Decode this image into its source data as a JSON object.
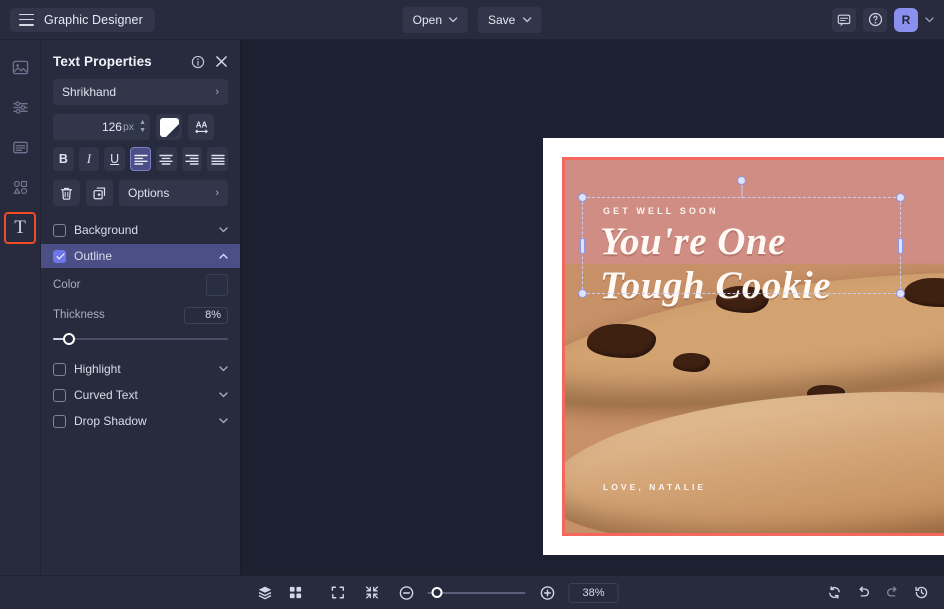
{
  "header": {
    "app_title": "Graphic Designer",
    "menu_icon": "hamburger-icon",
    "open_label": "Open",
    "save_label": "Save",
    "comment_icon": "comment-icon",
    "help_icon": "help-icon",
    "avatar_initial": "R",
    "avatar_color": "#8b8fee"
  },
  "rail": {
    "items": [
      {
        "name": "image-tool",
        "icon": "image-icon",
        "active": false
      },
      {
        "name": "adjust-tool",
        "icon": "sliders-icon",
        "active": false
      },
      {
        "name": "layout-tool",
        "icon": "text-box-icon",
        "active": false
      },
      {
        "name": "shapes-tool",
        "icon": "shapes-icon",
        "active": false
      },
      {
        "name": "text-tool",
        "icon": "text-T-icon",
        "active": true
      }
    ],
    "active_outline_color": "#f04b24"
  },
  "panel": {
    "title": "Text Properties",
    "info_icon": "info-icon",
    "close_icon": "close-icon",
    "font_family": "Shrikhand",
    "font_size": "126",
    "font_size_unit": "px",
    "color_swatch": "#ffffff",
    "letter_spacing_icon": "AA",
    "style_buttons": [
      {
        "name": "bold-button",
        "label": "B",
        "active": false
      },
      {
        "name": "italic-button",
        "label": "I",
        "active": false
      },
      {
        "name": "underline-button",
        "label": "U",
        "active": false
      }
    ],
    "align_buttons": [
      {
        "name": "align-left-button",
        "active": true
      },
      {
        "name": "align-center-button",
        "active": false
      },
      {
        "name": "align-right-button",
        "active": false
      },
      {
        "name": "align-justify-button",
        "active": false
      }
    ],
    "delete_icon": "trash-icon",
    "duplicate_icon": "duplicate-icon",
    "options_label": "Options",
    "accordions": [
      {
        "name": "background",
        "label": "Background",
        "checked": false,
        "expanded": false,
        "chevron": "down"
      },
      {
        "name": "outline",
        "label": "Outline",
        "checked": true,
        "expanded": true,
        "chevron": "up"
      },
      {
        "name": "highlight",
        "label": "Highlight",
        "checked": false,
        "expanded": false,
        "chevron": "down"
      },
      {
        "name": "curved-text",
        "label": "Curved Text",
        "checked": false,
        "expanded": false,
        "chevron": "down"
      },
      {
        "name": "drop-shadow",
        "label": "Drop Shadow",
        "checked": false,
        "expanded": false,
        "chevron": "down"
      }
    ],
    "outline": {
      "color_label": "Color",
      "color_value": "#2a2e45",
      "thickness_label": "Thickness",
      "thickness_value": "8%",
      "thickness_percent": 8
    },
    "accent_color": "#6f76e8"
  },
  "canvas": {
    "artwork": {
      "kicker": "GET WELL SOON",
      "headline_line1": "You're One",
      "headline_line2": "Tough Cookie",
      "signature": "LOVE, NATALIE",
      "background_color": "#cf8d84",
      "border_color": "#f4675f"
    },
    "selection": {
      "handle_color": "#dfe2fb",
      "outline_color": "#c9cdf5"
    }
  },
  "bottom": {
    "layers_icon": "layers-icon",
    "grid_icon": "grid-icon",
    "fit_icon": "fit-screen-icon",
    "shrink_icon": "shrink-icon",
    "zoom_out_icon": "zoom-out-icon",
    "zoom_in_icon": "zoom-in-icon",
    "zoom_level": "38%",
    "zoom_percent": 38,
    "sync_icon": "sync-icon",
    "undo_icon": "undo-icon",
    "redo_icon": "redo-icon",
    "history_icon": "history-icon"
  }
}
